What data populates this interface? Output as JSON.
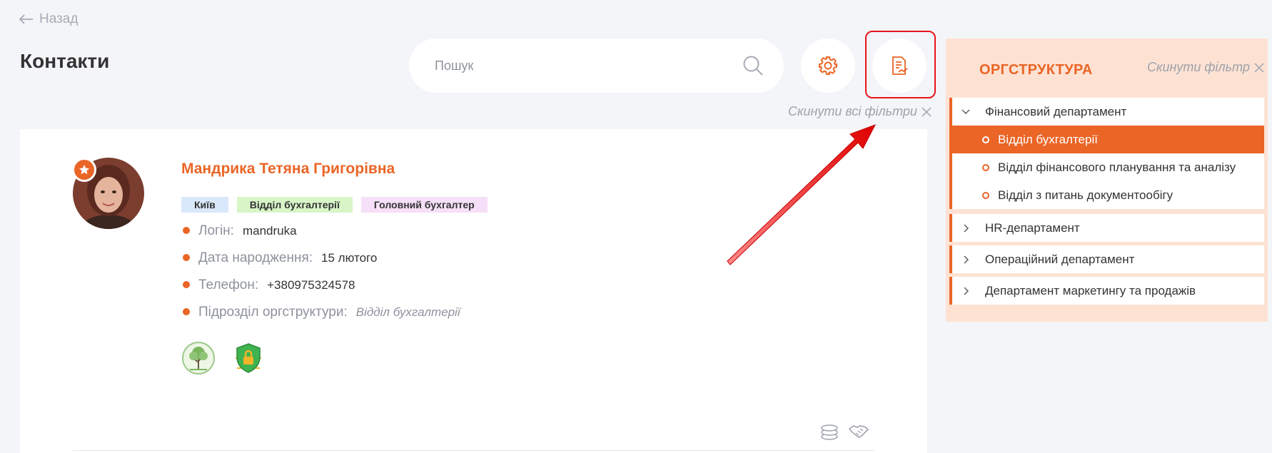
{
  "nav": {
    "back_label": "Назад"
  },
  "page": {
    "title": "Контакти"
  },
  "search": {
    "placeholder": "Пошук"
  },
  "filters": {
    "reset_all_label": "Скинути всі фільтри"
  },
  "contact": {
    "name": "Мандрика Тетяна Григорівна",
    "tags": {
      "city": "Київ",
      "department": "Відділ бухгалтерії",
      "position": "Головний бухгалтер"
    },
    "fields": [
      {
        "label": "Логін:",
        "value": "mandruka"
      },
      {
        "label": "Дата народження:",
        "value": "15 лютого"
      },
      {
        "label": "Телефон:",
        "value": "+380975324578"
      },
      {
        "label": "Підрозділ оргструктури:",
        "value": "Відділ бухгалтерії"
      }
    ],
    "badge_icons": [
      "tree-badge-icon",
      "security-shield-badge-icon"
    ],
    "action_icons": [
      "coins-icon",
      "handshake-icon"
    ]
  },
  "orgstructure": {
    "title": "ОРГСТРУКТУРА",
    "reset_label": "Скинути фільтр",
    "departments": [
      {
        "label": "Фінансовий департамент",
        "expanded": true,
        "children": [
          {
            "label": "Відділ бухгалтерії",
            "active": true
          },
          {
            "label": "Відділ фінансового планування та аналізу",
            "active": false
          },
          {
            "label": "Відділ з питань документообігу",
            "active": false
          }
        ]
      },
      {
        "label": "HR-департамент",
        "expanded": false
      },
      {
        "label": "Операційний департамент",
        "expanded": false
      },
      {
        "label": "Департамент маркетингу та продажів",
        "expanded": false
      }
    ]
  },
  "colors": {
    "accent": "#ea6526",
    "highlight": "#e8141b",
    "panel_bg": "#fde2d3",
    "page_bg": "#f4f5f8"
  }
}
